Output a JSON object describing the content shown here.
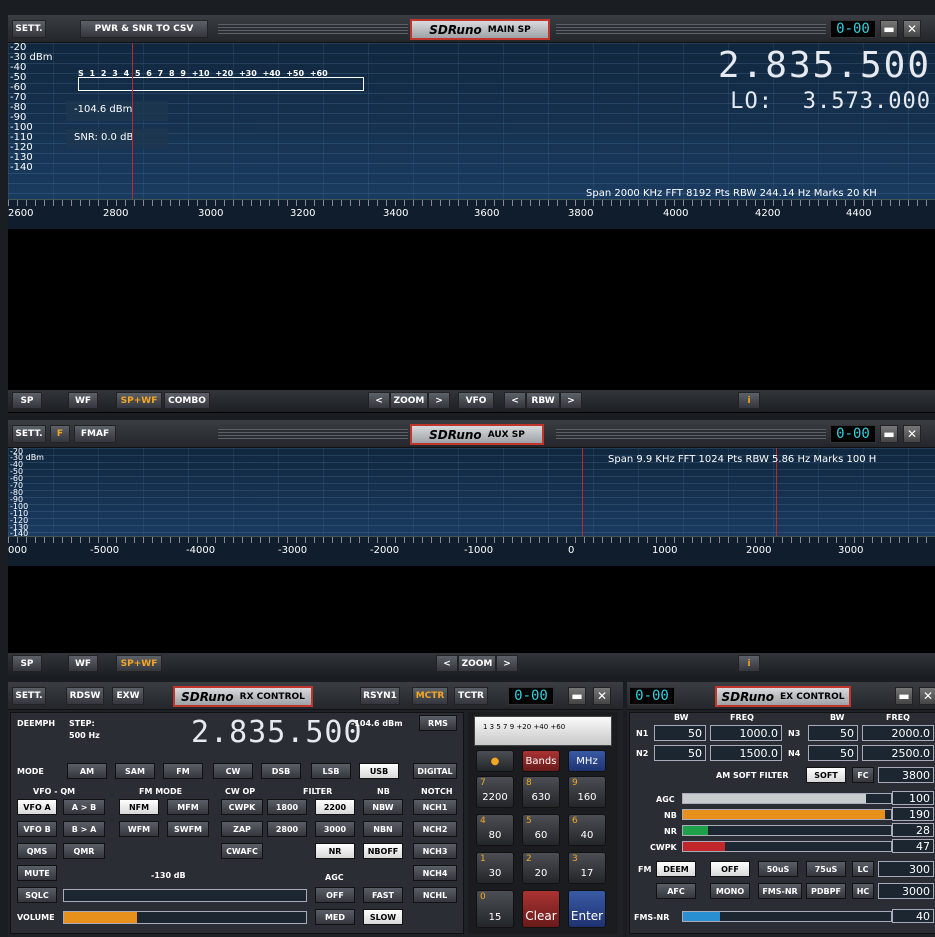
{
  "main_sp": {
    "sett": "SETT.",
    "pwr_csv": "PWR & SNR TO CSV",
    "logo": "SDRuno",
    "title": "MAIN SP",
    "clock": "0-00",
    "y_labels": [
      "-20",
      "-30 dBm",
      "-40",
      "-50",
      "-60",
      "-70",
      "-80",
      "-90",
      "-100",
      "-110",
      "-120",
      "-130",
      "-140"
    ],
    "s_labels": "S 1 2 3 4 5 6 7 8 9 +10 +20 +30 +40 +50 +60",
    "power": "-104.6 dBm",
    "snr": "SNR: 0.0 dB",
    "freq": "2.835.500",
    "lo_label": "LO:",
    "lo_freq": "3.573.000",
    "span_info": "Span 2000 KHz  FFT 8192 Pts  RBW 244.14 Hz  Marks 20 KH",
    "x_labels": [
      "2600",
      "2800",
      "3000",
      "3200",
      "3400",
      "3600",
      "3800",
      "4000",
      "4200",
      "4400"
    ],
    "bottom": {
      "sp": "SP",
      "wf": "WF",
      "spwf": "SP+WF",
      "combo": "COMBO",
      "zoom": "ZOOM",
      "vfo": "VFO",
      "rbw": "RBW",
      "info": "i",
      "lt": "<",
      "gt": ">"
    }
  },
  "aux_sp": {
    "sett": "SETT.",
    "f": "F",
    "fmaf": "FMAF",
    "logo": "SDRuno",
    "title": "AUX SP",
    "clock": "0-00",
    "y_labels": [
      "-20",
      "-30 dBm",
      "-40",
      "-50",
      "-60",
      "-70",
      "-80",
      "-90",
      "-100",
      "-110",
      "-120",
      "-130",
      "-140"
    ],
    "span_info": "Span 9.9 KHz  FFT 1024 Pts  RBW 5.86 Hz  Marks 100 H",
    "x_labels": [
      "000",
      "-5000",
      "-4000",
      "-3000",
      "-2000",
      "-1000",
      "0",
      "1000",
      "2000",
      "3000"
    ],
    "bottom": {
      "sp": "SP",
      "wf": "WF",
      "spwf": "SP+WF",
      "zoom": "ZOOM",
      "info": "i",
      "lt": "<",
      "gt": ">"
    }
  },
  "rx": {
    "sett": "SETT.",
    "rdsw": "RDSW",
    "exw": "EXW",
    "logo": "SDRuno",
    "title": "RX CONTROL",
    "rsyn1": "RSYN1",
    "mctr": "MCTR",
    "tctr": "TCTR",
    "clock": "0-00",
    "deemph": "DEEMPH",
    "step": "STEP:",
    "step_val": "500 Hz",
    "freq": "2.835.500",
    "level": "-104.6 dBm",
    "rms": "RMS",
    "mode_label": "MODE",
    "modes": [
      "AM",
      "SAM",
      "FM",
      "CW",
      "DSB",
      "LSB",
      "USB",
      "DIGITAL"
    ],
    "vfo_qm": "VFO - QM",
    "fm_mode": "FM MODE",
    "cw_op": "CW OP",
    "filter": "FILTER",
    "nb": "NB",
    "notch": "NOTCH",
    "row1": [
      "VFO A",
      "A > B",
      "NFM",
      "MFM",
      "CWPK",
      "1800",
      "2200",
      "NBW",
      "NCH1"
    ],
    "row2": [
      "VFO B",
      "B > A",
      "WFM",
      "SWFM",
      "ZAP",
      "2800",
      "3000",
      "NBN",
      "NCH2"
    ],
    "row3": [
      "QMS",
      "QMR",
      "CWAFC",
      "NR",
      "NBOFF",
      "NCH3"
    ],
    "mute": "MUTE",
    "squelch_db": "-130 dB",
    "agc": "AGC",
    "nch4": "NCH4",
    "sqlc": "SQLC",
    "off": "OFF",
    "fast": "FAST",
    "nchl": "NCHL",
    "volume": "VOLUME",
    "med": "MED",
    "slow": "SLOW",
    "meter_scale": "1 3 5 7 9 +20 +40 +60",
    "keypad": {
      "bands": "Bands",
      "mhz": "MHz",
      "k7": "7",
      "v7": "2200",
      "k8": "8",
      "v8": "630",
      "k9": "9",
      "v9": "160",
      "k4": "4",
      "v4": "80",
      "k5": "5",
      "v5": "60",
      "k6": "6",
      "v6": "40",
      "k1": "1",
      "v1": "30",
      "k2": "2",
      "v2": "20",
      "k3": "3",
      "v3": "17",
      "k0": "0",
      "v0": "15",
      "clear": "Clear",
      "enter": "Enter"
    }
  },
  "ex": {
    "clock": "0-00",
    "logo": "SDRuno",
    "title": "EX CONTROL",
    "bw": "BW",
    "freq": "FREQ",
    "n1": "N1",
    "n1_bw": "50",
    "n1_freq": "1000.0",
    "n3": "N3",
    "n3_bw": "50",
    "n3_freq": "2000.0",
    "n2": "N2",
    "n2_bw": "50",
    "n2_freq": "1500.0",
    "n4": "N4",
    "n4_bw": "50",
    "n4_freq": "2500.0",
    "am_soft": "AM SOFT FILTER",
    "soft": "SOFT",
    "fc": "FC",
    "fc_val": "3800",
    "agc": "AGC",
    "agc_val": "100",
    "nb": "NB",
    "nb_val": "190",
    "nr": "NR",
    "nr_val": "28",
    "cwpk": "CWPK",
    "cwpk_val": "47",
    "fm": "FM",
    "deem": "DEEM",
    "off": "OFF",
    "us50": "50uS",
    "us75": "75uS",
    "lc": "LC",
    "lc_val": "300",
    "afc": "AFC",
    "mono": "MONO",
    "fmsnr": "FMS-NR",
    "pdbpf": "PDBPF",
    "hc": "HC",
    "hc_val": "3000",
    "fmsnr_label": "FMS-NR",
    "fmsnr_val": "40",
    "colors": {
      "agc": "#c9cccf",
      "nb": "#e8901c",
      "nr": "#1fa04a",
      "cwpk": "#c0262a",
      "fmsnr": "#2a8fd0"
    },
    "levels": {
      "agc": 0.88,
      "nb": 0.97,
      "nr": 0.12,
      "cwpk": 0.2,
      "fmsnr": 0.18
    }
  }
}
